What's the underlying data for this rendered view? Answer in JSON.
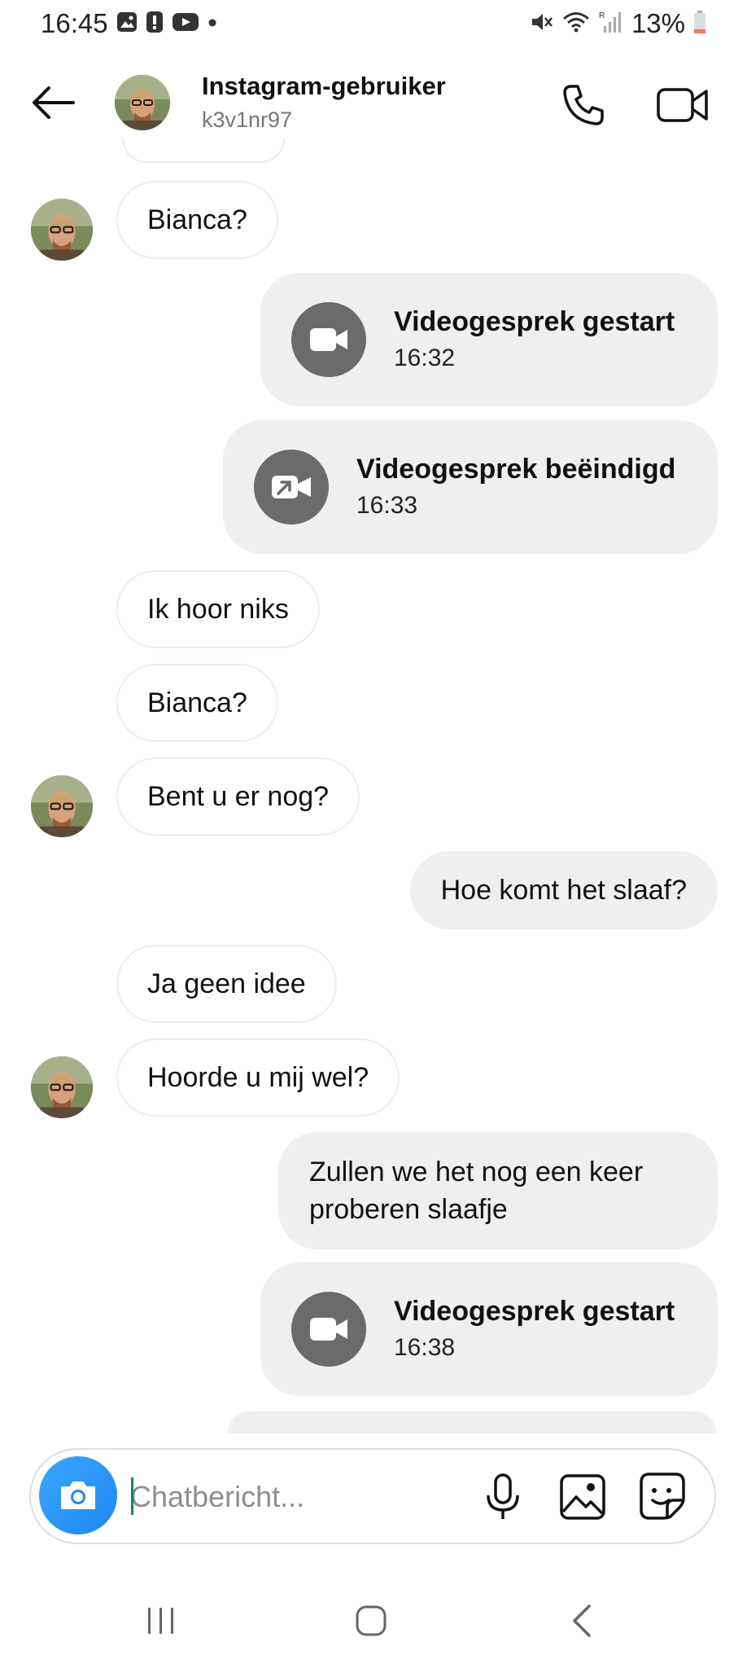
{
  "status_bar": {
    "time": "16:45",
    "battery": "13%",
    "left_icons": [
      "gallery-icon",
      "alert-icon",
      "youtube-icon",
      "dot-icon"
    ],
    "right_icons": [
      "mute-icon",
      "wifi-icon",
      "signal-icon",
      "battery-icon"
    ]
  },
  "header": {
    "title": "Instagram-gebruiker",
    "subtitle": "k3v1nr97",
    "icons": [
      "back-arrow-icon",
      "phone-icon",
      "video-camera-icon"
    ]
  },
  "messages": [
    {
      "type": "incoming",
      "text": "Bianca?"
    },
    {
      "type": "call",
      "title": "Videogesprek gestart",
      "time": "16:32",
      "icon": "video-camera-icon"
    },
    {
      "type": "call",
      "title": "Videogesprek beëindigd",
      "time": "16:33",
      "icon": "video-call-ended-icon"
    },
    {
      "type": "incoming",
      "text": "Ik hoor niks"
    },
    {
      "type": "incoming",
      "text": "Bianca?"
    },
    {
      "type": "incoming",
      "text": "Bent u er nog?"
    },
    {
      "type": "outgoing",
      "text": "Hoe komt het slaaf?"
    },
    {
      "type": "incoming",
      "text": "Ja geen idee"
    },
    {
      "type": "incoming",
      "text": "Hoorde u mij wel?"
    },
    {
      "type": "outgoing",
      "text": "Zullen we het nog een keer proberen slaafje"
    },
    {
      "type": "call",
      "title": "Videogesprek gestart",
      "time": "16:38",
      "icon": "video-camera-icon"
    }
  ],
  "composer": {
    "placeholder": "Chatbericht...",
    "value": "",
    "icons": [
      "camera-icon",
      "microphone-icon",
      "image-icon",
      "sticker-icon"
    ]
  },
  "colors": {
    "outgoing_bubble": "#efefef",
    "call_icon_bg": "#6b6b6b",
    "camera_button": "#2b96f7"
  }
}
